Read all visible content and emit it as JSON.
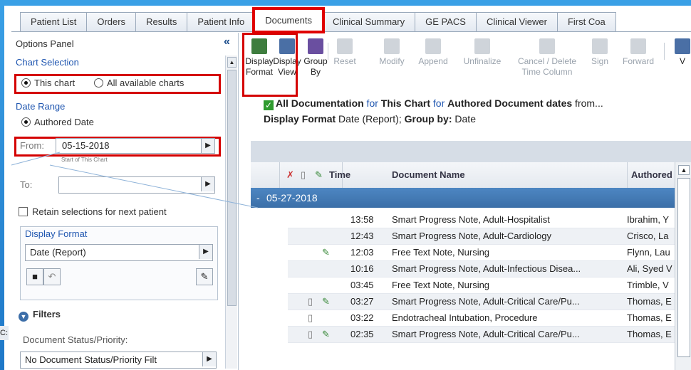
{
  "tabs": [
    "Patient List",
    "Orders",
    "Results",
    "Patient Info",
    "Documents",
    "Clinical Summary",
    "GE PACS",
    "Clinical Viewer",
    "First Coa"
  ],
  "active_tab": "Documents",
  "options_panel": {
    "title": "Options Panel",
    "collapse_glyph": "«",
    "chart_selection_label": "Chart Selection",
    "this_chart": "This chart",
    "all_charts": "All available charts",
    "date_range_label": "Date Range",
    "authored_date": "Authored Date",
    "from_label": "From:",
    "from_value": "05-15-2018",
    "from_hint": "Start of This Chart",
    "to_label": "To:",
    "to_value": "",
    "retain_label": "Retain selections for next patient",
    "display_format_label": "Display Format",
    "display_format_value": "Date (Report)",
    "filters_label": "Filters",
    "doc_status_label": "Document Status/Priority:",
    "doc_status_value": "No Document Status/Priority Filt"
  },
  "toolbar": [
    {
      "label1": "Display",
      "label2": "Format",
      "enabled": true,
      "icon": "display-format-icon",
      "color": "#3e7d3e"
    },
    {
      "label1": "Display",
      "label2": "View",
      "enabled": true,
      "icon": "display-view-icon",
      "color": "#4a6fa5"
    },
    {
      "label1": "Group",
      "label2": "By",
      "enabled": true,
      "icon": "group-by-icon",
      "color": "#6a4fa0"
    },
    {
      "label1": "Reset",
      "label2": "",
      "enabled": false,
      "icon": "reset-icon"
    },
    {
      "label1": "Modify",
      "label2": "",
      "enabled": false,
      "icon": "modify-icon"
    },
    {
      "label1": "Append",
      "label2": "",
      "enabled": false,
      "icon": "append-icon"
    },
    {
      "label1": "Unfinalize",
      "label2": "",
      "enabled": false,
      "icon": "unfinalize-icon"
    },
    {
      "label1": "Cancel / Delete",
      "label2": "Time Column",
      "enabled": false,
      "icon": "cancel-delete-icon"
    },
    {
      "label1": "Sign",
      "label2": "",
      "enabled": false,
      "icon": "sign-icon"
    },
    {
      "label1": "Forward",
      "label2": "",
      "enabled": false,
      "icon": "forward-icon"
    },
    {
      "label1": "V",
      "label2": "",
      "enabled": true,
      "icon": "view-icon",
      "color": "#4a6fa5"
    }
  ],
  "summary": {
    "line1_a": "All Documentation",
    "line1_b": " for ",
    "line1_c": "This Chart",
    "line1_d": " for ",
    "line1_e": "Authored Document dates",
    "line1_f": " from...",
    "line2_a": "Display Format",
    "line2_b": " Date (Report); ",
    "line2_c": "Group by:",
    "line2_d": " Date"
  },
  "grid": {
    "headers": {
      "time": "Time",
      "name": "Document Name",
      "authored": "Authored"
    },
    "group_date": "05-27-2018",
    "group_toggle": "-",
    "rows": [
      {
        "time": "13:58",
        "name": "Smart Progress Note, Adult-Hospitalist",
        "author": "Ibrahim, Y",
        "icons": ""
      },
      {
        "time": "12:43",
        "name": "Smart Progress Note, Adult-Cardiology",
        "author": "Crisco, La",
        "icons": ""
      },
      {
        "time": "12:03",
        "name": "Free Text Note, Nursing",
        "author": "Flynn, Lau",
        "icons": "pen"
      },
      {
        "time": "10:16",
        "name": "Smart Progress Note, Adult-Infectious Disea...",
        "author": "Ali, Syed V",
        "icons": ""
      },
      {
        "time": "03:45",
        "name": "Free Text Note, Nursing",
        "author": "Trimble, V",
        "icons": ""
      },
      {
        "time": "03:27",
        "name": "Smart Progress Note, Adult-Critical Care/Pu...",
        "author": "Thomas, E",
        "icons": "doc-pen"
      },
      {
        "time": "03:22",
        "name": "Endotracheal Intubation, Procedure",
        "author": "Thomas, E",
        "icons": "doc"
      },
      {
        "time": "02:35",
        "name": "Smart Progress Note, Adult-Critical Care/Pu...",
        "author": "Thomas, E",
        "icons": "doc-pen"
      }
    ]
  },
  "left_edge_label": "C:"
}
